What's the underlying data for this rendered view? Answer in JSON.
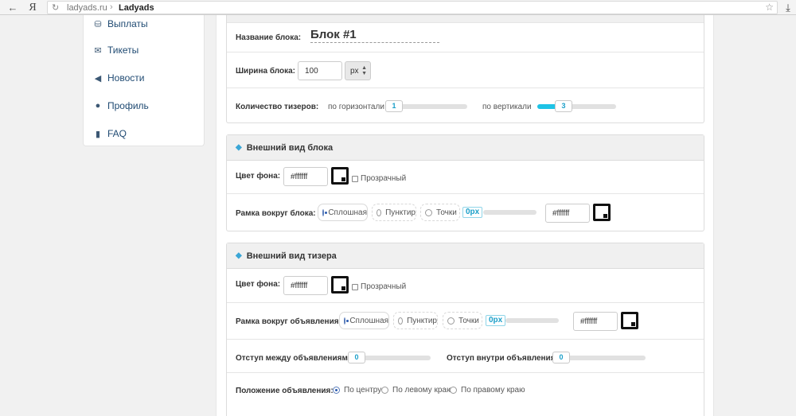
{
  "browser": {
    "domain": "ladyads.ru",
    "separator": "›",
    "title": "Ladyads"
  },
  "sidebar": {
    "items": [
      {
        "label": "Выплаты",
        "icon": "database-icon"
      },
      {
        "label": "Тикеты",
        "icon": "envelope-icon"
      },
      {
        "label": "Новости",
        "icon": "speaker-icon"
      },
      {
        "label": "Профиль",
        "icon": "user-icon"
      },
      {
        "label": "FAQ",
        "icon": "book-icon"
      }
    ]
  },
  "block_settings": {
    "name_label": "Название блока:",
    "name_value": "Блок #1",
    "width_label": "Ширина блока:",
    "width_value": "100",
    "width_unit": "px",
    "teaser_count_label": "Количество тизеров:",
    "horizontal_label": "по горизонтали",
    "horizontal_value": "1",
    "vertical_label": "по вертикали",
    "vertical_value": "3"
  },
  "block_appearance": {
    "title": "Внешний вид блока",
    "bg_label": "Цвет фона:",
    "bg_value": "#ffffff",
    "transparent_label": "Прозрачный",
    "border_label": "Рамка вокруг блока:",
    "border_options": [
      "Сплошная",
      "Пунктир",
      "Точки"
    ],
    "border_selected": "Сплошная",
    "border_width": "0px",
    "border_color": "#ffffff"
  },
  "teaser_appearance": {
    "title": "Внешний вид тизера",
    "bg_label": "Цвет фона:",
    "bg_value": "#ffffff",
    "transparent_label": "Прозрачный",
    "border_label": "Рамка вокруг объявления:",
    "border_options": [
      "Сплошная",
      "Пунктир",
      "Точки"
    ],
    "border_selected": "Сплошная",
    "border_width": "0px",
    "border_color": "#ffffff",
    "gap_between_label": "Отступ между объявлениями:",
    "gap_between_value": "0",
    "gap_inside_label": "Отступ внутри объявления:",
    "gap_inside_value": "0",
    "position_label": "Положение объявления:",
    "position_options": [
      "По центру",
      "По левому краю",
      "По правому краю"
    ],
    "position_selected": "По центру"
  },
  "colors": {
    "accent": "#1ec3e6",
    "link": "#1f4a72"
  }
}
